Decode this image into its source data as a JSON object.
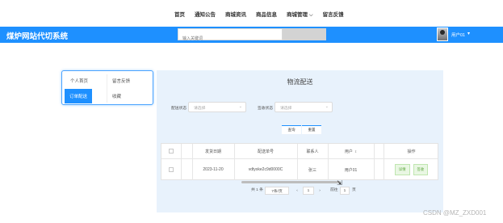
{
  "topnav": {
    "items": [
      "首页",
      "通知公告",
      "商城资讯",
      "商品信息",
      "商城管理",
      "留言反馈"
    ]
  },
  "header": {
    "site_title": "煤炉网站代切系统",
    "search_placeholder": "输入关键词",
    "search_button": "",
    "username": "用户01"
  },
  "left_menu": {
    "items": [
      "个人首页",
      "留言反馈",
      "订单配送",
      "收藏"
    ],
    "active": "订单配送"
  },
  "panel": {
    "title": "物流配送",
    "filters": [
      {
        "label": "配送状态",
        "placeholder": "请选择"
      },
      {
        "label": "签收状态",
        "placeholder": "请选择"
      }
    ],
    "query_button": "查询",
    "reset_button": "重置"
  },
  "table": {
    "columns": [
      "",
      "",
      "发货日期",
      "配送单号",
      "联系人",
      "用户",
      "",
      "操作"
    ],
    "sort_icon": "sort-icon",
    "rows": [
      {
        "date": "2023-11-20",
        "order_no": "vdtyxke2c9d0000C",
        "contact": "张三",
        "user": "用户01",
        "actions": [
          "详情",
          "签收"
        ]
      }
    ]
  },
  "pagination": {
    "total": "共 1 条",
    "page_size": "7条/页",
    "prev": "‹",
    "current_page": "1",
    "next": "›",
    "goto_label": "前往",
    "goto_value": "1",
    "page_suffix": "页"
  },
  "watermark": "CSDN @MZ_ZXD001",
  "colors": {
    "accent": "#1e90ff",
    "panel_bg": "#e8f2fc",
    "action_green": "#5aa53c"
  }
}
